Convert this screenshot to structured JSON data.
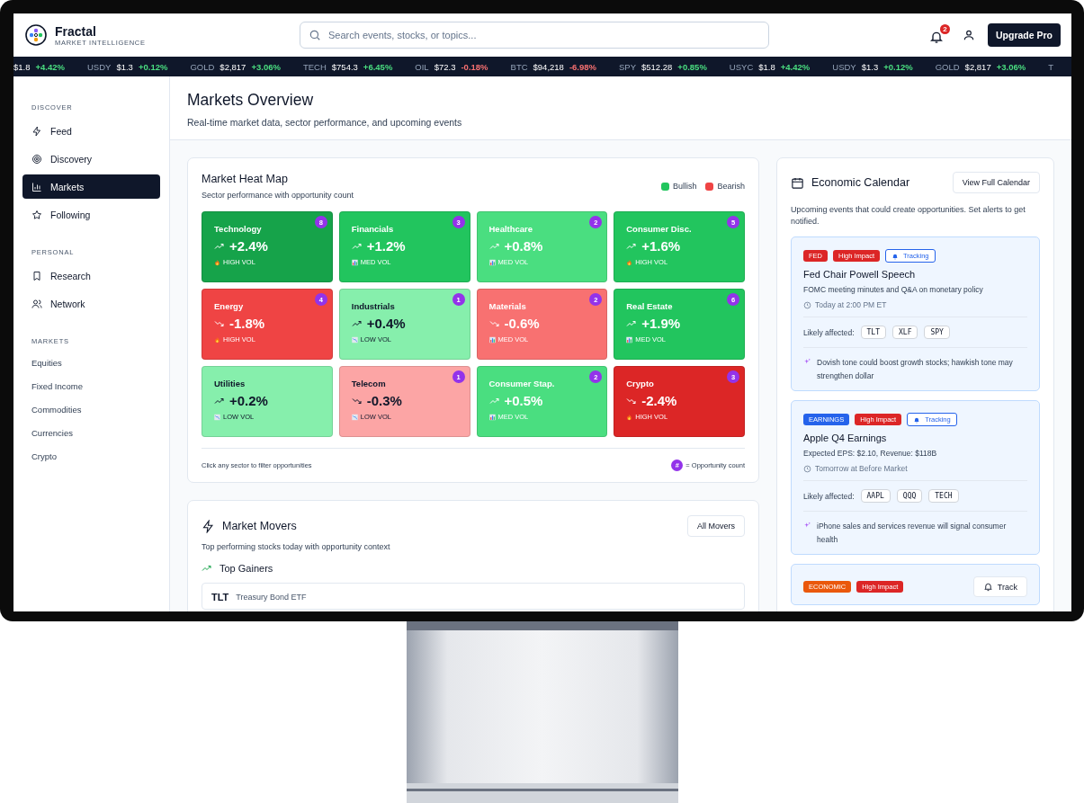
{
  "brand": {
    "name": "Fractal",
    "tagline": "MARKET INTELLIGENCE"
  },
  "search": {
    "placeholder": "Search events, stocks, or topics..."
  },
  "notifications": {
    "count": "2"
  },
  "upgrade_button": "Upgrade Pro",
  "ticker": [
    {
      "price": "$1.8",
      "change": "+4.42%",
      "color": "#4ade80"
    },
    {
      "symbol": "USDY",
      "price": "$1.3",
      "change": "+0.12%",
      "color": "#4ade80"
    },
    {
      "symbol": "GOLD",
      "price": "$2,817",
      "change": "+3.06%",
      "color": "#4ade80"
    },
    {
      "symbol": "TECH",
      "price": "$754.3",
      "change": "+6.45%",
      "color": "#4ade80"
    },
    {
      "symbol": "OIL",
      "price": "$72.3",
      "change": "-0.18%",
      "color": "#f87171"
    },
    {
      "symbol": "BTC",
      "price": "$94,218",
      "change": "-6.98%",
      "color": "#f87171"
    },
    {
      "symbol": "SPY",
      "price": "$512.28",
      "change": "+0.85%",
      "color": "#4ade80"
    },
    {
      "symbol": "USYC",
      "price": "$1.8",
      "change": "+4.42%",
      "color": "#4ade80"
    },
    {
      "symbol": "USDY",
      "price": "$1.3",
      "change": "+0.12%",
      "color": "#4ade80"
    },
    {
      "symbol": "GOLD",
      "price": "$2,817",
      "change": "+3.06%",
      "color": "#4ade80"
    },
    {
      "symbol": "T"
    }
  ],
  "sidebar": [
    {
      "heading": "DISCOVER",
      "items": [
        {
          "label": "Feed",
          "selected": false
        },
        {
          "label": "Discovery",
          "selected": false
        },
        {
          "label": "Markets",
          "selected": true
        },
        {
          "label": "Following",
          "selected": false
        }
      ]
    },
    {
      "heading": "PERSONAL",
      "items": [
        {
          "label": "Research",
          "selected": false
        },
        {
          "label": "Network",
          "selected": false
        }
      ]
    },
    {
      "heading": "MARKETS",
      "items": [
        {
          "label": "Equities",
          "selected": false
        },
        {
          "label": "Fixed Income",
          "selected": false
        },
        {
          "label": "Commodities",
          "selected": false
        },
        {
          "label": "Currencies",
          "selected": false
        },
        {
          "label": "Crypto",
          "selected": false
        }
      ]
    }
  ],
  "page": {
    "title": "Markets Overview",
    "subtitle": "Real-time market data, sector performance, and upcoming events"
  },
  "heat_map": {
    "title": "Market Heat Map",
    "subtitle": "Sector performance with opportunity count",
    "legend": [
      {
        "label": "Bullish",
        "color": "#22c55e"
      },
      {
        "label": "Bearish",
        "color": "#ef4444"
      }
    ],
    "sectors": [
      {
        "name": "Technology",
        "change": "+2.4%",
        "kind": "up",
        "volume": {
          "kind": "high",
          "label": "HIGH VOL"
        },
        "count": "8",
        "color": "#16a34a"
      },
      {
        "name": "Financials",
        "change": "+1.2%",
        "kind": "up",
        "volume": {
          "kind": "med",
          "label": "MED VOL"
        },
        "count": "3",
        "color": "#22c55e"
      },
      {
        "name": "Healthcare",
        "change": "+0.8%",
        "kind": "up",
        "volume": {
          "kind": "med",
          "label": "MED VOL"
        },
        "count": "2",
        "color": "#4ade80"
      },
      {
        "name": "Consumer Disc.",
        "change": "+1.6%",
        "kind": "up",
        "volume": {
          "kind": "high",
          "label": "HIGH VOL"
        },
        "count": "5",
        "color": "#22c55e"
      },
      {
        "name": "Energy",
        "change": "-1.8%",
        "kind": "down",
        "volume": {
          "kind": "high",
          "label": "HIGH VOL"
        },
        "count": "4",
        "color": "#ef4444"
      },
      {
        "name": "Industrials",
        "change": "+0.4%",
        "kind": "up",
        "volume": {
          "kind": "low",
          "label": "LOW VOL"
        },
        "count": "1",
        "color": "#86efac"
      },
      {
        "name": "Materials",
        "change": "-0.6%",
        "kind": "down",
        "volume": {
          "kind": "med",
          "label": "MED VOL"
        },
        "count": "2",
        "color": "#f87171"
      },
      {
        "name": "Real Estate",
        "change": "+1.9%",
        "kind": "up",
        "volume": {
          "kind": "med",
          "label": "MED VOL"
        },
        "count": "6",
        "color": "#22c55e"
      },
      {
        "name": "Utilities",
        "change": "+0.2%",
        "kind": "up",
        "volume": {
          "kind": "low",
          "label": "LOW VOL"
        },
        "color": "#86efac"
      },
      {
        "name": "Telecom",
        "change": "-0.3%",
        "kind": "down",
        "volume": {
          "kind": "low",
          "label": "LOW VOL"
        },
        "count": "1",
        "color": "#fca5a5"
      },
      {
        "name": "Consumer Stap.",
        "change": "+0.5%",
        "kind": "up",
        "volume": {
          "kind": "med",
          "label": "MED VOL"
        },
        "count": "2",
        "color": "#4ade80"
      },
      {
        "name": "Crypto",
        "change": "-2.4%",
        "kind": "down",
        "volume": {
          "kind": "high",
          "label": "HIGH VOL"
        },
        "count": "3",
        "color": "#dc2626"
      }
    ],
    "footer_note": "Click any sector to filter opportunities",
    "count_key_symbol": "#",
    "count_key_label": "= Opportunity count"
  },
  "movers": {
    "title": "Market Movers",
    "button": "All Movers",
    "subtitle": "Top performing stocks today with opportunity context",
    "section": "Top Gainers",
    "rows": [
      {
        "symbol": "TLT",
        "name": "Treasury Bond ETF"
      }
    ]
  },
  "calendar": {
    "title": "Economic Calendar",
    "button": "View Full Calendar",
    "subtitle": "Upcoming events that could create opportunities. Set alerts to get notified.",
    "events": [
      {
        "category": {
          "label": "FED",
          "color": "#dc2626"
        },
        "impact": "High Impact",
        "tracking": true,
        "tracking_label": "Tracking",
        "title": "Fed Chair Powell Speech",
        "description": "FOMC meeting minutes and Q&A on monetary policy",
        "time": "Today at 2:00 PM ET",
        "affected_label": "Likely affected:",
        "tickers": [
          "TLT",
          "XLF",
          "SPY"
        ],
        "insight": "Dovish tone could boost growth stocks; hawkish tone may strengthen dollar"
      },
      {
        "category": {
          "label": "EARNINGS",
          "color": "#2563eb"
        },
        "impact": "High Impact",
        "tracking": true,
        "tracking_label": "Tracking",
        "title": "Apple Q4 Earnings",
        "description": "Expected EPS: $2.10, Revenue: $118B",
        "time": "Tomorrow at Before Market",
        "affected_label": "Likely affected:",
        "tickers": [
          "AAPL",
          "QQQ",
          "TECH"
        ],
        "insight": "iPhone sales and services revenue will signal consumer health"
      },
      {
        "category": {
          "label": "ECONOMIC",
          "color": "#ea580c"
        },
        "impact": "High Impact",
        "tracking": false,
        "tracking_label": "Track"
      }
    ]
  }
}
